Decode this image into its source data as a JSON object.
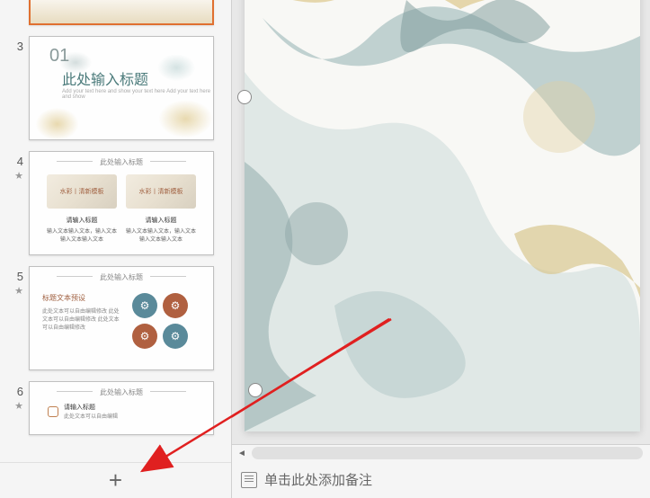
{
  "thumbnails": {
    "slide3": {
      "number": "3",
      "section_number": "01",
      "title": "此处输入标题",
      "subtitle": "Add your text here and show your text here Add your text here and show"
    },
    "slide4": {
      "number": "4",
      "star": "★",
      "header": "此处输入标题",
      "box1": "水彩丨清新模板",
      "box2": "水彩丨清新模板",
      "text1_title": "请输入标题",
      "text2_title": "请输入标题",
      "text1": "输入文本输入文本，输入文本输入文本输入文本",
      "text2": "输入文本输入文本，输入文本输入文本输入文本"
    },
    "slide5": {
      "number": "5",
      "star": "★",
      "header": "此处输入标题",
      "left_title": "标题文本预设",
      "left_text": "此处文本可以自由编辑修改 此处文本可以自由编辑修改 此处文本可以自由编辑修改"
    },
    "slide6": {
      "number": "6",
      "star": "★",
      "header": "此处输入标题",
      "item1_title": "请输入标题",
      "item1_text": "此处文本可以自由编辑"
    }
  },
  "add_button": "+",
  "notes": {
    "placeholder": "单击此处添加备注"
  },
  "scroll": {
    "left_arrow": "◄"
  }
}
